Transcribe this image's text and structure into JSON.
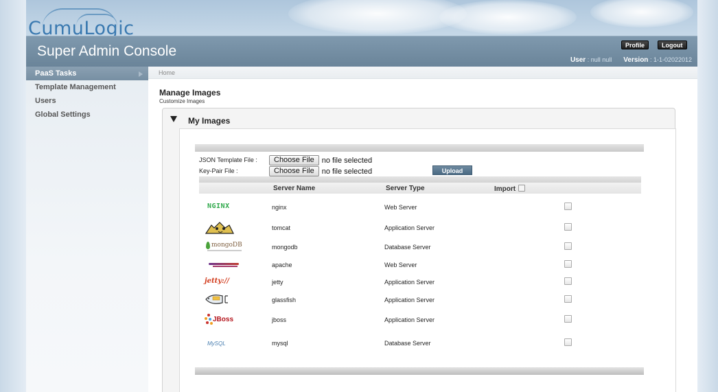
{
  "brand": {
    "logo_text": "CumuLogic"
  },
  "header": {
    "title": "Super Admin Console",
    "profile_label": "Profile",
    "logout_label": "Logout",
    "user_label": "User",
    "user_value": ": null null",
    "version_label": "Version",
    "version_value": ": 1-1-02022012"
  },
  "sidebar": {
    "items": [
      {
        "label": "PaaS Tasks",
        "active": true
      },
      {
        "label": "Template Management"
      },
      {
        "label": "Users"
      },
      {
        "label": "Global Settings"
      }
    ]
  },
  "breadcrumb": "Home",
  "main": {
    "heading": "Manage Images",
    "subheading": "Customize Images",
    "panel_title": "My Images",
    "json_template_label": "JSON Template File :",
    "keypair_label": "Key-Pair File :",
    "choose_file_label": "Choose File",
    "no_file_text": "no file selected",
    "upload_label": "Upload"
  },
  "table": {
    "columns": [
      "Server Name",
      "Server Type",
      "Import"
    ],
    "rows": [
      {
        "logo": "nginx-logo",
        "logo_text": "NGINX",
        "name": "nginx",
        "type": "Web Server",
        "checked": false
      },
      {
        "logo": "tomcat-logo",
        "name": "tomcat",
        "type": "Application Server",
        "checked": false
      },
      {
        "logo": "mongodb-logo",
        "logo_text": "mongoDB",
        "name": "mongodb",
        "type": "Database Server",
        "checked": false
      },
      {
        "logo": "apache-logo",
        "name": "apache",
        "type": "Web Server",
        "checked": false
      },
      {
        "logo": "jetty-logo",
        "logo_text": "jetty://",
        "name": "jetty",
        "type": "Application Server",
        "checked": false
      },
      {
        "logo": "glassfish-logo",
        "name": "glassfish",
        "type": "Application Server",
        "checked": false
      },
      {
        "logo": "jboss-logo",
        "logo_text": "JBoss",
        "name": "jboss",
        "type": "Application Server",
        "checked": false
      },
      {
        "logo": "mysql-logo",
        "logo_text": "MySQL",
        "name": "mysql",
        "type": "Database Server",
        "checked": false
      }
    ]
  },
  "colors": {
    "header_bar": "#7590a6",
    "brand_blue": "#3a79b0",
    "upload_button": "#5a7890"
  }
}
